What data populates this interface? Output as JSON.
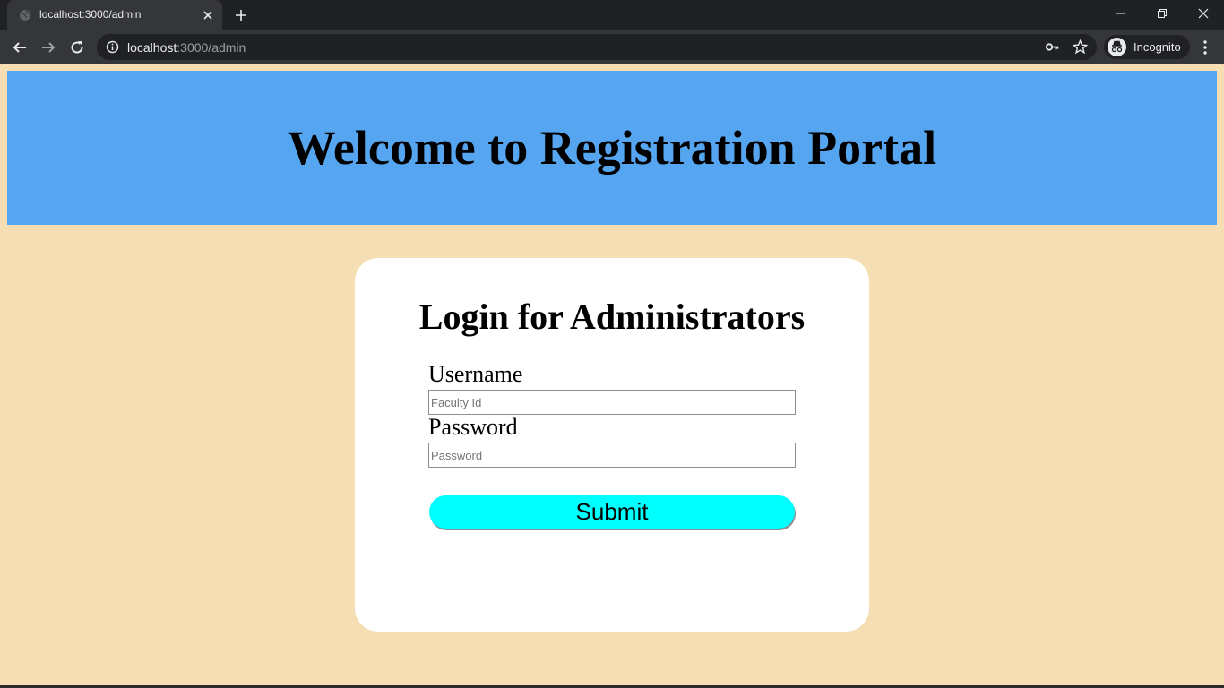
{
  "browser": {
    "tab_title": "localhost:3000/admin",
    "url_host": "localhost",
    "url_rest": ":3000/admin",
    "incognito_label": "Incognito"
  },
  "page": {
    "header_title": "Welcome to Registration Portal",
    "login_title": "Login for Administrators",
    "username_label": "Username",
    "username_placeholder": "Faculty Id",
    "password_label": "Password",
    "password_placeholder": "Password",
    "submit_label": "Submit"
  },
  "colors": {
    "page_background": "#f5deb3",
    "header_background": "#56a5f0",
    "submit_background": "#00ffff"
  }
}
